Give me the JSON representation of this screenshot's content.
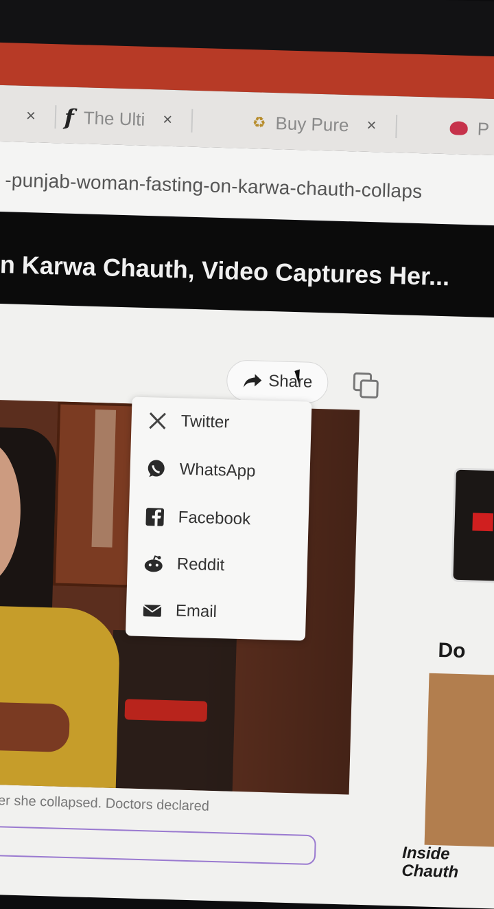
{
  "browser": {
    "tabs": [
      {
        "label": "",
        "close": "×"
      },
      {
        "label": "The Ulti",
        "close": "×",
        "icon": "f-logo-icon"
      },
      {
        "label": "Buy Pure",
        "close": "×",
        "icon": "recycle-icon"
      },
      {
        "label": "P",
        "icon": "bird-logo-icon"
      }
    ],
    "url": "-punjab-woman-fasting-on-karwa-chauth-collaps"
  },
  "article": {
    "title": "n Karwa Chauth, Video Captures Her...",
    "share_label": "Share",
    "caption": "tal after she collapsed. Doctors declared"
  },
  "share_menu": {
    "items": [
      {
        "label": "Twitter",
        "icon": "x-twitter-icon"
      },
      {
        "label": "WhatsApp",
        "icon": "whatsapp-icon"
      },
      {
        "label": "Facebook",
        "icon": "facebook-icon"
      },
      {
        "label": "Reddit",
        "icon": "reddit-icon"
      },
      {
        "label": "Email",
        "icon": "envelope-icon"
      }
    ]
  },
  "sidebar": {
    "heading": "Do",
    "story_title_line1": "Inside",
    "story_title_line2": "Chauth"
  },
  "colors": {
    "red_band": "#b73a26",
    "title_bar": "#0b0b0b"
  }
}
